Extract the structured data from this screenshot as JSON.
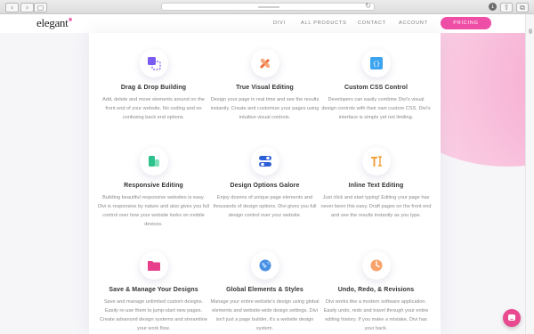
{
  "header": {
    "logo": "elegant",
    "nav": [
      "DIVI",
      "ALL PRODUCTS",
      "CONTACT",
      "ACCOUNT"
    ],
    "pricing_label": "PRICING"
  },
  "colors": {
    "accent": "#ef4ea7",
    "chat": "#e8498f"
  },
  "features": [
    {
      "icon": "drag-drop-icon",
      "title": "Drag & Drop Building",
      "desc": "Add, delete and move elements around on the front end of your website. No coding and no confusing back end options."
    },
    {
      "icon": "visual-editing-icon",
      "title": "True Visual Editing",
      "desc": "Design your page in real time and see the results instantly. Create and customize your pages using intuitive visual controls."
    },
    {
      "icon": "css-control-icon",
      "title": "Custom CSS Control",
      "desc": "Developers can easily combine Divi's visual design controls with their own custom CSS. Divi's interface is simple yet not limiting."
    },
    {
      "icon": "responsive-editing-icon",
      "title": "Responsive Editing",
      "desc": "Building beautiful responsive websites is easy. Divi is responsive by nature and also gives you full control over how your website looks on mobile devices."
    },
    {
      "icon": "design-options-icon",
      "title": "Design Options Galore",
      "desc": "Enjoy dozens of unique page elements and thousands of design options. Divi gives you full design control over your website."
    },
    {
      "icon": "inline-text-icon",
      "title": "Inline Text Editing",
      "desc": "Just click and start typing! Editing your page has never been this easy. Draft pages on the front end and see the results instantly as you type."
    },
    {
      "icon": "save-manage-icon",
      "title": "Save & Manage Your Designs",
      "desc": "Save and manage unlimited custom designs. Easily re-use them to jump-start new pages. Create advanced design systems and streamline your work flow."
    },
    {
      "icon": "global-elements-icon",
      "title": "Global Elements & Styles",
      "desc": "Manage your entire website's design using global elements and website-wide design settings. Divi isn't just a page builder, it's a website design system."
    },
    {
      "icon": "undo-redo-icon",
      "title": "Undo, Redo, & Revisions",
      "desc": "Divi works like a modern software application. Easily undo, redo and travel through your entire editing history. If you make a mistake, Divi has your back."
    }
  ]
}
